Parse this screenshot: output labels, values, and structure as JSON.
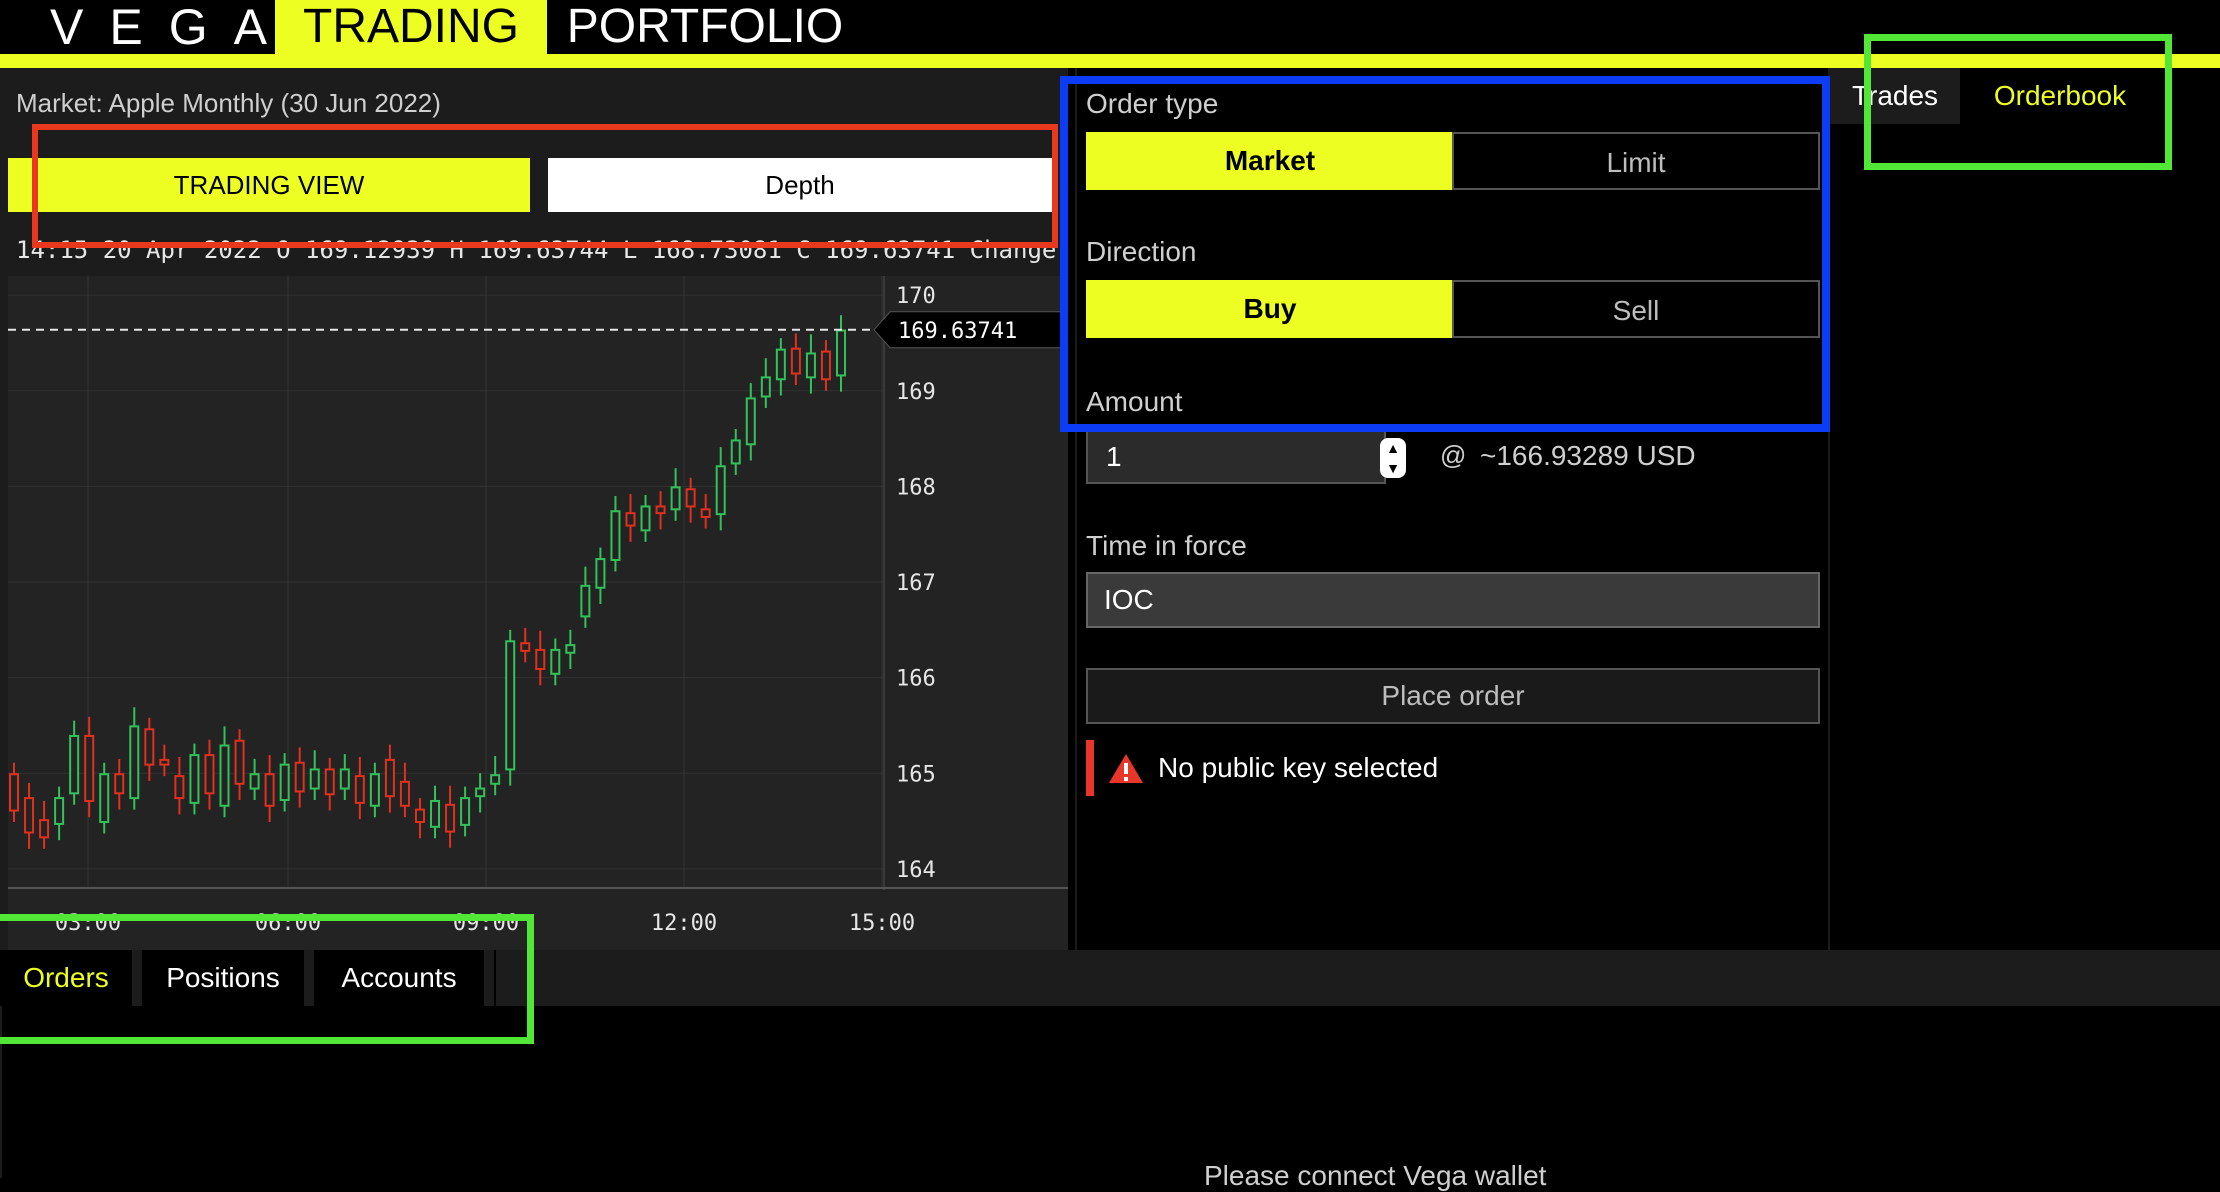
{
  "header": {
    "logo": "VEGA",
    "nav": {
      "trading": "TRADING",
      "portfolio": "PORTFOLIO"
    }
  },
  "colors": {
    "accent": "#edff22",
    "up": "#33c25a",
    "down": "#e0301e",
    "error": "#e8372a",
    "annotation_red": "#e8381e",
    "annotation_blue": "#0d3cf6",
    "annotation_green": "#52e636"
  },
  "market": {
    "title": "Market: Apple Monthly (30 Jun 2022)"
  },
  "chart_tabs": {
    "trading_view": "TRADING VIEW",
    "depth": "Depth"
  },
  "ohlc_line": "14:15 20 Apr 2022  O 169.12939  H 169.63744  L 168.73081  C 169.63741  Change",
  "chart_data": {
    "type": "candlestick",
    "x_ticks": [
      "03:00",
      "06:00",
      "09:00",
      "12:00",
      "15:00"
    ],
    "y_ticks": [
      "170",
      "169",
      "168",
      "167",
      "166",
      "165",
      "164"
    ],
    "ylim": [
      163.8,
      170.2
    ],
    "last_price": "169.63741",
    "candles": [
      [
        164.99,
        164.61
      ],
      [
        164.74,
        164.38
      ],
      [
        164.51,
        164.33
      ],
      [
        164.47,
        164.74
      ],
      [
        164.79,
        165.39
      ],
      [
        165.39,
        164.71
      ],
      [
        164.49,
        164.99
      ],
      [
        164.99,
        164.79
      ],
      [
        164.74,
        165.49
      ],
      [
        165.46,
        165.09
      ],
      [
        165.14,
        165.09
      ],
      [
        164.97,
        164.74
      ],
      [
        164.69,
        165.19
      ],
      [
        165.19,
        164.79
      ],
      [
        164.66,
        165.29
      ],
      [
        165.34,
        164.89
      ],
      [
        164.84,
        164.99
      ],
      [
        164.99,
        164.66
      ],
      [
        164.72,
        165.09
      ],
      [
        165.11,
        164.81
      ],
      [
        164.84,
        165.04
      ],
      [
        165.04,
        164.78
      ],
      [
        164.84,
        165.04
      ],
      [
        164.97,
        164.69
      ],
      [
        164.66,
        164.99
      ],
      [
        165.14,
        164.76
      ],
      [
        164.91,
        164.66
      ],
      [
        164.62,
        164.49
      ],
      [
        164.44,
        164.71
      ],
      [
        164.67,
        164.39
      ],
      [
        164.46,
        164.74
      ],
      [
        164.76,
        164.84
      ],
      [
        164.89,
        164.98
      ],
      [
        165.04,
        166.38
      ],
      [
        166.36,
        166.28
      ],
      [
        166.29,
        166.09
      ],
      [
        166.04,
        166.29
      ],
      [
        166.26,
        166.34
      ],
      [
        166.64,
        166.96
      ],
      [
        166.94,
        167.24
      ],
      [
        167.23,
        167.74
      ],
      [
        167.72,
        167.59
      ],
      [
        167.54,
        167.79
      ],
      [
        167.79,
        167.72
      ],
      [
        167.76,
        167.99
      ],
      [
        167.97,
        167.79
      ],
      [
        167.76,
        167.68
      ],
      [
        167.71,
        168.21
      ],
      [
        168.24,
        168.48
      ],
      [
        168.44,
        168.92
      ],
      [
        168.94,
        169.14
      ],
      [
        169.12,
        169.43
      ],
      [
        169.44,
        169.18
      ],
      [
        169.14,
        169.39
      ],
      [
        169.41,
        169.12
      ],
      [
        169.16,
        169.63
      ]
    ]
  },
  "order_form": {
    "order_type": {
      "label": "Order type",
      "options": [
        "Market",
        "Limit"
      ],
      "selected": "Market"
    },
    "direction": {
      "label": "Direction",
      "options": [
        "Buy",
        "Sell"
      ],
      "selected": "Buy"
    },
    "amount": {
      "label": "Amount",
      "value": "1",
      "at": "@",
      "approx_price": "~166.93289 USD"
    },
    "time_in_force": {
      "label": "Time in force",
      "value": "IOC"
    },
    "place_order": "Place order",
    "error": "No public key selected"
  },
  "side_tabs": {
    "trades": "Trades",
    "orderbook": "Orderbook"
  },
  "bottom_tabs": {
    "orders": "Orders",
    "positions": "Positions",
    "accounts": "Accounts"
  },
  "bottom_message": "Please connect Vega wallet"
}
